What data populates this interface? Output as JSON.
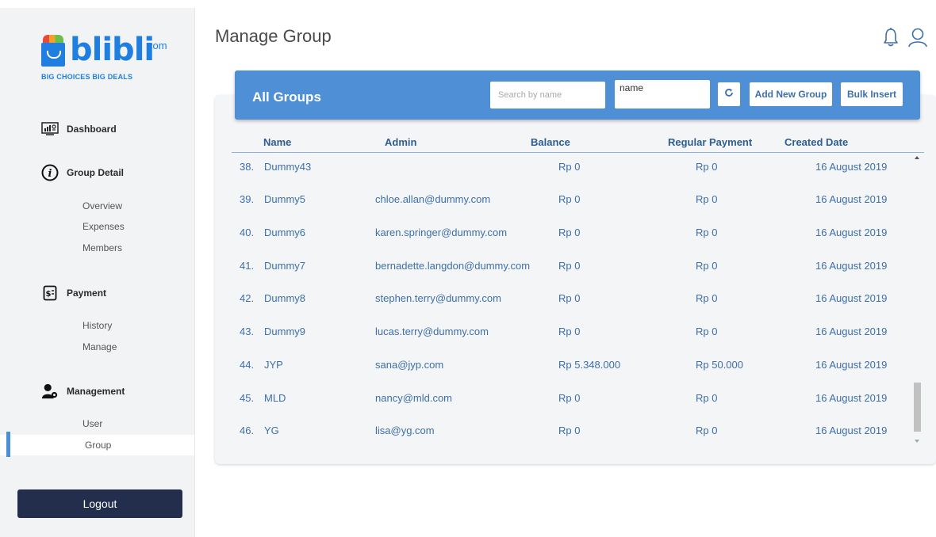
{
  "brand": {
    "name": "blibli",
    "suffix": "com",
    "tagline": "BIG CHOICES  BIG DEALS"
  },
  "sidebar": {
    "dashboard": "Dashboard",
    "group_detail": "Group Detail",
    "group_detail_items": [
      "Overview",
      "Expenses",
      "Members"
    ],
    "payment": "Payment",
    "payment_items": [
      "History",
      "Manage"
    ],
    "management": "Management",
    "management_items": [
      "User",
      "Group"
    ],
    "logout": "Logout"
  },
  "header": {
    "title": "Manage Group"
  },
  "toolbar": {
    "title": "All Groups",
    "search_placeholder": "Search by name",
    "sort_value": "name",
    "add_label": "Add New Group",
    "bulk_label": "Bulk Insert"
  },
  "table": {
    "columns": [
      "Name",
      "Admin",
      "Balance",
      "Regular Payment",
      "Created Date"
    ],
    "rows": [
      {
        "num": "38.",
        "name": "Dummy43",
        "admin": "",
        "balance": "Rp 0",
        "regular": "Rp 0",
        "created": "16 August 2019"
      },
      {
        "num": "39.",
        "name": "Dummy5",
        "admin": "chloe.allan@dummy.com",
        "balance": "Rp 0",
        "regular": "Rp 0",
        "created": "16 August 2019"
      },
      {
        "num": "40.",
        "name": "Dummy6",
        "admin": "karen.springer@dummy.com",
        "balance": "Rp 0",
        "regular": "Rp 0",
        "created": "16 August 2019"
      },
      {
        "num": "41.",
        "name": "Dummy7",
        "admin": "bernadette.langdon@dummy.com",
        "balance": "Rp 0",
        "regular": "Rp 0",
        "created": "16 August 2019"
      },
      {
        "num": "42.",
        "name": "Dummy8",
        "admin": "stephen.terry@dummy.com",
        "balance": "Rp 0",
        "regular": "Rp 0",
        "created": "16 August 2019"
      },
      {
        "num": "43.",
        "name": "Dummy9",
        "admin": "lucas.terry@dummy.com",
        "balance": "Rp 0",
        "regular": "Rp 0",
        "created": "16 August 2019"
      },
      {
        "num": "44.",
        "name": "JYP",
        "admin": "sana@jyp.com",
        "balance": "Rp 5.348.000",
        "regular": "Rp 50.000",
        "created": "16 August 2019"
      },
      {
        "num": "45.",
        "name": "MLD",
        "admin": "nancy@mld.com",
        "balance": "Rp 0",
        "regular": "Rp 0",
        "created": "16 August 2019"
      },
      {
        "num": "46.",
        "name": "YG",
        "admin": "lisa@yg.com",
        "balance": "Rp 0",
        "regular": "Rp 0",
        "created": "16 August 2019"
      }
    ]
  },
  "colors": {
    "accent": "#4f8fd6",
    "sidebar_bg": "#f2f3f5",
    "logout_bg": "#222e4b",
    "link": "#3d6fa8"
  },
  "icons": [
    "dashboard-icon",
    "info-icon",
    "payment-icon",
    "management-icon",
    "bell-icon",
    "user-icon",
    "refresh-icon"
  ]
}
